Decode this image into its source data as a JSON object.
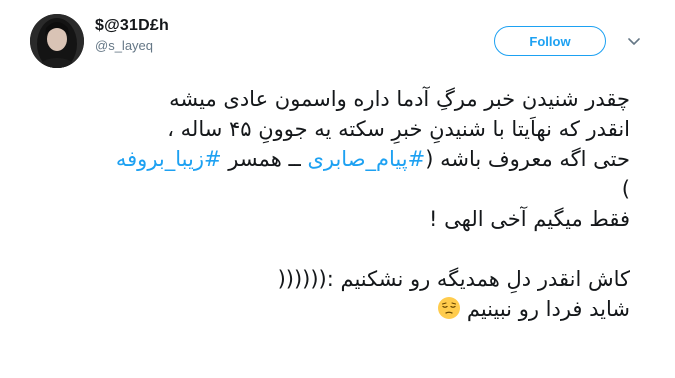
{
  "user": {
    "display_name": "$@31D£h",
    "handle": "@s_layeq"
  },
  "follow_button": {
    "label": "Follow"
  },
  "colors": {
    "accent": "#1da1f2",
    "text": "#14171a",
    "muted": "#657786"
  },
  "icons": {
    "menu": "chevron-down-icon",
    "emoji": "pensive-face-emoji"
  },
  "tweet": {
    "line1": "چقدر شنیدن خبر مرگِ آدما داره واسمون عادی میشه",
    "line2": "انقدر که نهاَیتا با شنیدنِ خبرِ سکته یه جوونِ ۴۵ ساله ،",
    "line3_pre": "حتی اگه معروف باشه (",
    "hashtag1": "#پیام_صابری",
    "line3_mid": " ــ همسر ",
    "hashtag2": "#زیبا_بروفه",
    "line4": ")",
    "line5": "فقط میگیم آخی الهی !",
    "line6": "کاش انقدر دلِ همدیگه رو نشکنیم :((((((",
    "line7": "شاید فردا رو نبینیم"
  }
}
